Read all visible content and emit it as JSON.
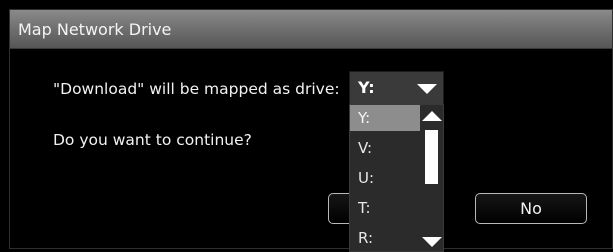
{
  "dialog": {
    "title": "Map Network Drive",
    "message": "\"Download\" will be mapped as drive:",
    "question": "Do you want to continue?"
  },
  "drive_select": {
    "selected": "Y:",
    "options": [
      "Y:",
      "V:",
      "U:",
      "T:",
      "R:"
    ],
    "highlighted_index": 0
  },
  "buttons": {
    "yes_label": "",
    "no_label": "No"
  },
  "icons": {
    "dropdown": "chevron-down-icon",
    "scroll_up": "scroll-up-icon",
    "scroll_down": "scroll-down-icon"
  }
}
